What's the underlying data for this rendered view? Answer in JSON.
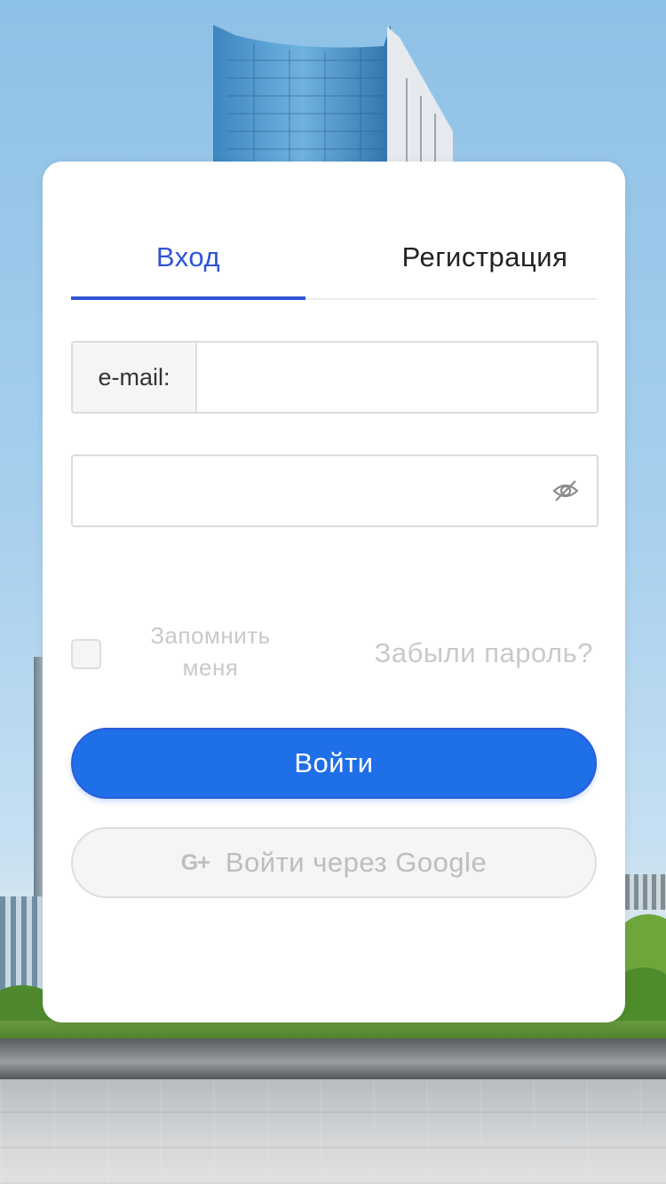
{
  "tabs": {
    "login_label": "Вход",
    "register_label": "Регистрация"
  },
  "email": {
    "addon_label": "e-mail:",
    "value": "",
    "placeholder": ""
  },
  "password": {
    "value": "",
    "placeholder": "",
    "toggle_icon": "eye-slash-icon"
  },
  "remember": {
    "label_line1": "Запомнить",
    "label_line2": "меня",
    "checked": false
  },
  "forgot_link": "Забыли пароль?",
  "login_button": "Войти",
  "google_button": {
    "icon_text": "G+",
    "label": "Войти через Google"
  },
  "colors": {
    "accent": "#2f54d4",
    "primary_button": "#1f6fe8",
    "disabled_text": "#c9c9c9"
  }
}
